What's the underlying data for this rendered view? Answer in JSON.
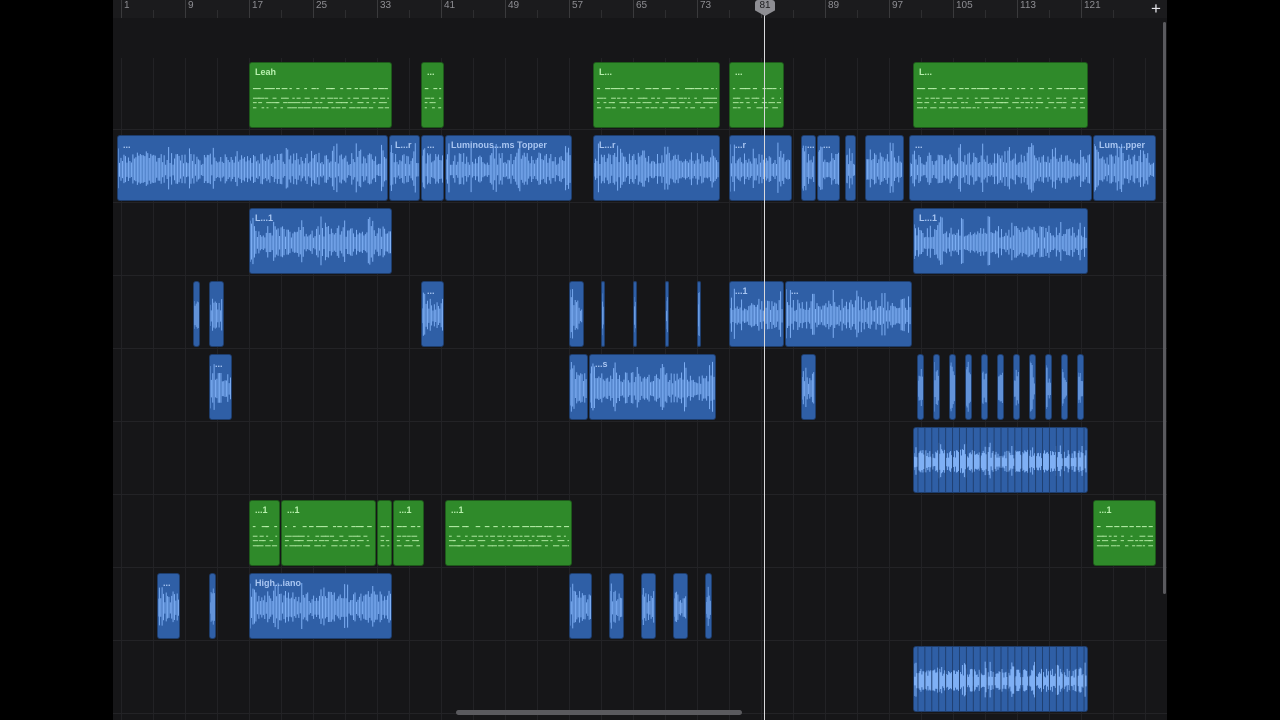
{
  "ruler": {
    "bars": [
      "1",
      "9",
      "17",
      "25",
      "33",
      "41",
      "49",
      "57",
      "65",
      "73",
      "81",
      "89",
      "97",
      "105",
      "113",
      "121"
    ],
    "add_label": "+"
  },
  "playhead": {
    "bar_label": "81"
  },
  "colors": {
    "audio": "#2f5fa6",
    "midi": "#2f8a2a",
    "playhead": "#d9d9dc"
  },
  "tracks": [
    {
      "regions": [
        {
          "type": "midi",
          "name": "Leah",
          "start": 17,
          "len": 18
        },
        {
          "type": "midi",
          "name": "...",
          "start": 38.5,
          "len": 3
        },
        {
          "type": "midi",
          "name": "L...",
          "start": 60,
          "len": 16
        },
        {
          "type": "midi",
          "name": "...",
          "start": 77,
          "len": 7
        },
        {
          "type": "midi",
          "name": "L...",
          "start": 100,
          "len": 22
        }
      ]
    },
    {
      "regions": [
        {
          "type": "audio",
          "name": "...",
          "start": 0.5,
          "len": 34
        },
        {
          "type": "audio",
          "name": "L...r",
          "start": 34.5,
          "len": 4
        },
        {
          "type": "audio",
          "name": "...",
          "start": 38.5,
          "len": 3
        },
        {
          "type": "audio",
          "name": "Luminous...ms Topper",
          "start": 41.5,
          "len": 16
        },
        {
          "type": "audio",
          "name": "L...r",
          "start": 60,
          "len": 16
        },
        {
          "type": "audio",
          "name": "...r",
          "start": 77,
          "len": 8
        },
        {
          "type": "audio",
          "name": "...",
          "start": 86,
          "len": 2
        },
        {
          "type": "audio",
          "name": "...",
          "start": 88,
          "len": 3
        },
        {
          "type": "audio",
          "name": "",
          "start": 91.5,
          "len": 1.5
        },
        {
          "type": "audio",
          "name": "",
          "start": 94,
          "len": 5
        },
        {
          "type": "audio",
          "name": "...",
          "start": 99.5,
          "len": 23
        },
        {
          "type": "audio",
          "name": "Lum...pper",
          "start": 122.5,
          "len": 8
        }
      ]
    },
    {
      "regions": [
        {
          "type": "audio",
          "name": "L...1",
          "start": 17,
          "len": 18
        },
        {
          "type": "audio",
          "name": "L...1",
          "start": 100,
          "len": 22
        }
      ]
    },
    {
      "regions": [
        {
          "type": "audio",
          "name": "",
          "start": 10,
          "len": 1
        },
        {
          "type": "audio",
          "name": "",
          "start": 12,
          "len": 2
        },
        {
          "type": "audio",
          "name": "...",
          "start": 38.5,
          "len": 3
        },
        {
          "type": "audio",
          "name": "",
          "start": 57,
          "len": 2
        },
        {
          "type": "audio",
          "name": "",
          "start": 61,
          "len": 0.5
        },
        {
          "type": "audio",
          "name": "",
          "start": 65,
          "len": 0.5
        },
        {
          "type": "audio",
          "name": "",
          "start": 69,
          "len": 0.5
        },
        {
          "type": "audio",
          "name": "",
          "start": 73,
          "len": 0.5
        },
        {
          "type": "audio",
          "name": "...1",
          "start": 77,
          "len": 7
        },
        {
          "type": "audio",
          "name": "...",
          "start": 84,
          "len": 16
        }
      ]
    },
    {
      "regions": [
        {
          "type": "audio",
          "name": "...",
          "start": 12,
          "len": 3
        },
        {
          "type": "audio",
          "name": "",
          "start": 57,
          "len": 2.5
        },
        {
          "type": "audio",
          "name": "...s",
          "start": 59.5,
          "len": 16
        },
        {
          "type": "audio",
          "name": "",
          "start": 86,
          "len": 2
        },
        {
          "type": "audio",
          "name": "",
          "start": 100.5,
          "len": 1
        },
        {
          "type": "audio",
          "name": "",
          "start": 102.5,
          "len": 1
        },
        {
          "type": "audio",
          "name": "",
          "start": 104.5,
          "len": 1
        },
        {
          "type": "audio",
          "name": "",
          "start": 106.5,
          "len": 1
        },
        {
          "type": "audio",
          "name": "",
          "start": 108.5,
          "len": 1
        },
        {
          "type": "audio",
          "name": "",
          "start": 110.5,
          "len": 1
        },
        {
          "type": "audio",
          "name": "",
          "start": 112.5,
          "len": 1
        },
        {
          "type": "audio",
          "name": "",
          "start": 114.5,
          "len": 1
        },
        {
          "type": "audio",
          "name": "",
          "start": 116.5,
          "len": 1
        },
        {
          "type": "audio",
          "name": "",
          "start": 118.5,
          "len": 1
        },
        {
          "type": "audio",
          "name": "",
          "start": 120.5,
          "len": 1
        }
      ]
    },
    {
      "regions": [
        {
          "type": "audio",
          "name": "",
          "start": 100,
          "len": 22,
          "dense": true
        }
      ]
    },
    {
      "regions": [
        {
          "type": "midi",
          "name": "...1",
          "start": 17,
          "len": 4
        },
        {
          "type": "midi",
          "name": "...1",
          "start": 21,
          "len": 12
        },
        {
          "type": "midi",
          "name": "",
          "start": 33,
          "len": 2
        },
        {
          "type": "midi",
          "name": "...1",
          "start": 35,
          "len": 4
        },
        {
          "type": "midi",
          "name": "...1",
          "start": 41.5,
          "len": 16
        },
        {
          "type": "midi",
          "name": "...1",
          "start": 122.5,
          "len": 8
        }
      ]
    },
    {
      "regions": [
        {
          "type": "audio",
          "name": "...",
          "start": 5.5,
          "len": 3
        },
        {
          "type": "audio",
          "name": "",
          "start": 12,
          "len": 1
        },
        {
          "type": "audio",
          "name": "High...iano",
          "start": 17,
          "len": 18
        },
        {
          "type": "audio",
          "name": "",
          "start": 57,
          "len": 3
        },
        {
          "type": "audio",
          "name": "",
          "start": 62,
          "len": 2
        },
        {
          "type": "audio",
          "name": "",
          "start": 66,
          "len": 2
        },
        {
          "type": "audio",
          "name": "",
          "start": 70,
          "len": 2
        },
        {
          "type": "audio",
          "name": "",
          "start": 74,
          "len": 1
        }
      ]
    },
    {
      "regions": [
        {
          "type": "audio",
          "name": "",
          "start": 100,
          "len": 22,
          "dense": true
        }
      ]
    }
  ]
}
